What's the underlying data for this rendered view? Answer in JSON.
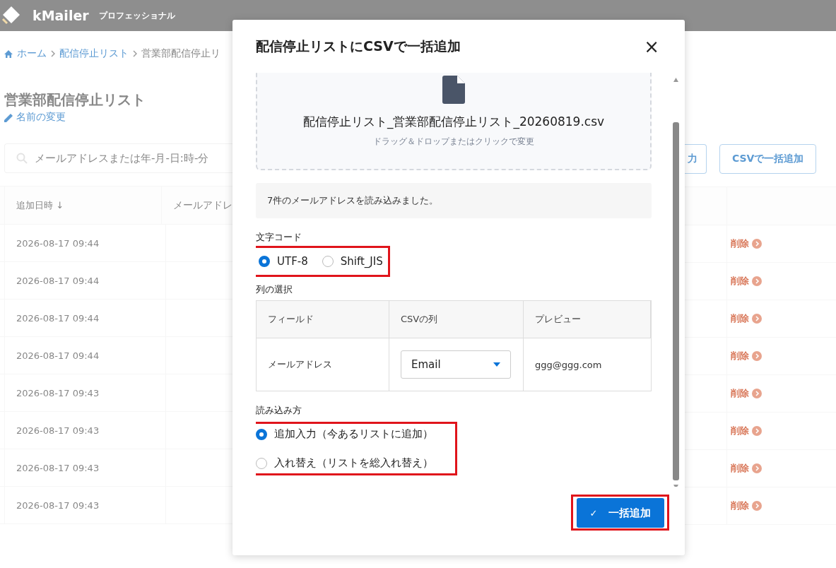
{
  "app_bar": {
    "brand": "kMailer",
    "edition": "プロフェッショナル"
  },
  "breadcrumb": [
    "ホーム",
    "配信停止リスト",
    "営業部配信停止リ"
  ],
  "page_title": "営業部配信停止リスト",
  "rename_link": "名前の変更",
  "search": {
    "placeholder": "メールアドレスまたは年-月-日:時-分"
  },
  "toolbar_buttons": [
    "力",
    "CSVで一括追加"
  ],
  "table": {
    "columns": [
      "追加日時 ↓",
      "メールアドレ"
    ],
    "rows": [
      {
        "added": "2026-08-17 09:44",
        "action": "削除"
      },
      {
        "added": "2026-08-17 09:44",
        "action": "削除"
      },
      {
        "added": "2026-08-17 09:44",
        "action": "削除"
      },
      {
        "added": "2026-08-17 09:44",
        "action": "削除"
      },
      {
        "added": "2026-08-17 09:43",
        "action": "削除"
      },
      {
        "added": "2026-08-17 09:43",
        "action": "削除"
      },
      {
        "added": "2026-08-17 09:43",
        "action": "削除"
      },
      {
        "added": "2026-08-17 09:43",
        "action": "削除"
      }
    ]
  },
  "dialog": {
    "title": "配信停止リストにCSVで一括追加",
    "close": "×",
    "dropzone": {
      "filename": "配信停止リスト_営業部配信停止リスト_20260819.csv",
      "hint": "ドラッグ＆ドロップまたはクリックで変更"
    },
    "notice": "7件のメールアドレスを読み込みました。",
    "encoding": {
      "label": "文字コード",
      "highlighted": true,
      "options": [
        {
          "label": "UTF-8",
          "selected": true
        },
        {
          "label": "Shift_JIS",
          "selected": false
        }
      ]
    },
    "columns": {
      "label": "列の選択",
      "headers": [
        "フィールド",
        "CSVの列",
        "プレビュー"
      ],
      "rows": [
        {
          "field": "メールアドレス",
          "csv_column": "Email",
          "preview": "ggg@ggg.com"
        }
      ]
    },
    "mode": {
      "label": "読み込み方",
      "highlighted": true,
      "options": [
        {
          "label": "追加入力（今あるリストに追加）",
          "selected": true
        },
        {
          "label": "入れ替え（リストを総入れ替え）",
          "selected": false
        }
      ]
    },
    "submit": {
      "label": "一括追加",
      "icon": "✓",
      "highlighted": true
    }
  }
}
